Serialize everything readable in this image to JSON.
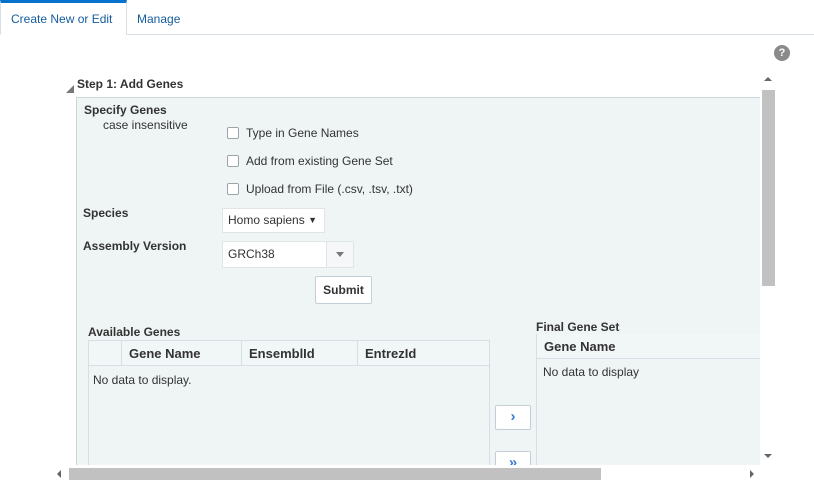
{
  "tabs": [
    {
      "label": "Create New or Edit",
      "active": true
    },
    {
      "label": "Manage",
      "active": false
    }
  ],
  "help": {
    "icon": "question-mark-icon",
    "glyph": "?"
  },
  "step": {
    "title": "Step 1: Add Genes"
  },
  "specify": {
    "label": "Specify Genes",
    "hint": "case insensitive",
    "options": [
      {
        "label": "Type in Gene Names",
        "checked": false
      },
      {
        "label": "Add from existing Gene Set",
        "checked": false
      },
      {
        "label": "Upload from File (.csv, .tsv, .txt)",
        "checked": false
      }
    ]
  },
  "species": {
    "label": "Species",
    "value": "Homo sapiens"
  },
  "assembly": {
    "label": "Assembly Version",
    "value": "GRCh38"
  },
  "submit_label": "Submit",
  "available": {
    "title": "Available Genes",
    "columns": [
      "Gene Name",
      "EnsemblId",
      "EntrezId"
    ],
    "empty": "No data to display."
  },
  "shuttle": {
    "move_glyph": "›",
    "move_all_glyph": "»"
  },
  "final": {
    "title": "Final Gene Set",
    "columns": [
      "Gene Name"
    ],
    "empty": "No data to display"
  }
}
